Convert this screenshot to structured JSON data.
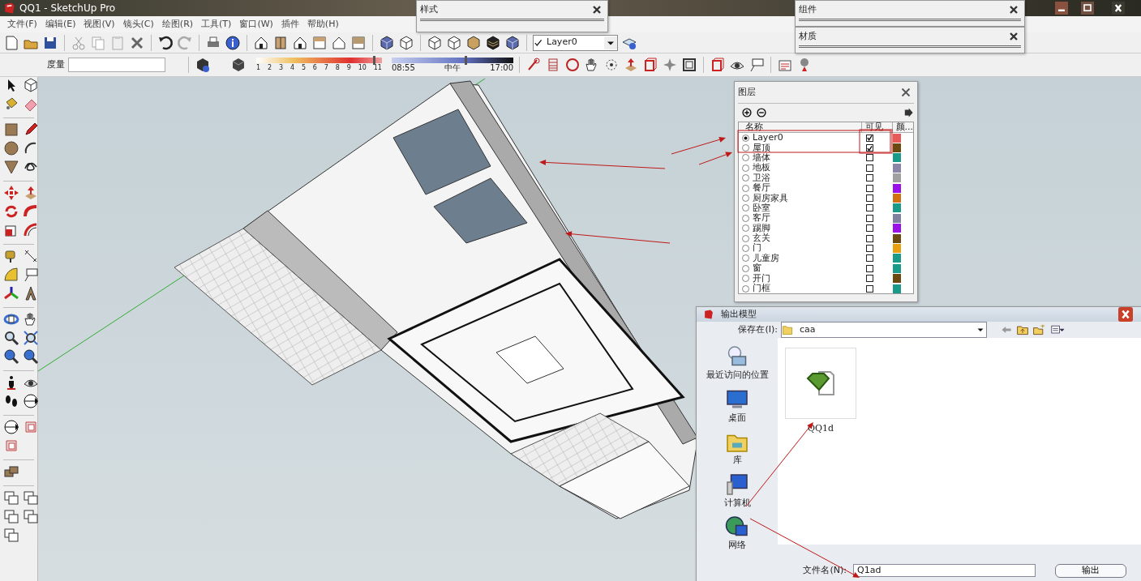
{
  "window": {
    "title": "QQ1 - SketchUp Pro"
  },
  "menu": [
    "文件(F)",
    "编辑(E)",
    "视图(V)",
    "镜头(C)",
    "绘图(R)",
    "工具(T)",
    "窗口(W)",
    "插件",
    "帮助(H)"
  ],
  "layer_select": {
    "value": "Layer0"
  },
  "measure": {
    "label": "度量"
  },
  "shadow": {
    "month_slider": {
      "labels": [
        "1",
        "2",
        "3",
        "4",
        "5",
        "6",
        "7",
        "8",
        "9",
        "10",
        "11"
      ],
      "level": 0.93
    },
    "time_slider": {
      "labels": [
        "08:55",
        "中午",
        "17:00"
      ],
      "level": 0.6
    }
  },
  "panels": [
    {
      "title": "样式"
    },
    {
      "title": "组件"
    },
    {
      "title": "材质"
    }
  ],
  "layers": {
    "title": "图层",
    "columns": [
      "名称",
      "可见",
      "颜..."
    ],
    "rows": [
      {
        "name": "Layer0",
        "selected": true,
        "visible": true,
        "color": "#e85a5a"
      },
      {
        "name": "屋顶",
        "selected": false,
        "visible": true,
        "color": "#6b4a10"
      },
      {
        "name": "墙体",
        "selected": false,
        "visible": false,
        "color": "#1a9b8a"
      },
      {
        "name": "地板",
        "selected": false,
        "visible": false,
        "color": "#8a86a8"
      },
      {
        "name": "卫浴",
        "selected": false,
        "visible": false,
        "color": "#a0a0a0"
      },
      {
        "name": "餐厅",
        "selected": false,
        "visible": false,
        "color": "#9a10e8"
      },
      {
        "name": "厨房家具",
        "selected": false,
        "visible": false,
        "color": "#d07010"
      },
      {
        "name": "卧室",
        "selected": false,
        "visible": false,
        "color": "#1a9b8a"
      },
      {
        "name": "客厅",
        "selected": false,
        "visible": false,
        "color": "#8080a0"
      },
      {
        "name": "踢脚",
        "selected": false,
        "visible": false,
        "color": "#9a10e8"
      },
      {
        "name": "玄关",
        "selected": false,
        "visible": false,
        "color": "#6b4a10"
      },
      {
        "name": "门",
        "selected": false,
        "visible": false,
        "color": "#e8a010"
      },
      {
        "name": "儿童房",
        "selected": false,
        "visible": false,
        "color": "#1a9b8a"
      },
      {
        "name": "窗",
        "selected": false,
        "visible": false,
        "color": "#1a9b8a"
      },
      {
        "name": "开门",
        "selected": false,
        "visible": false,
        "color": "#6b4a10"
      },
      {
        "name": "门框",
        "selected": false,
        "visible": false,
        "color": "#1a9b8a"
      }
    ]
  },
  "export_dialog": {
    "title": "输出模型",
    "save_in_label": "保存在(I):",
    "folder": "caa",
    "places": [
      {
        "label": "最近访问的位置",
        "kind": "recent"
      },
      {
        "label": "桌面",
        "kind": "desktop"
      },
      {
        "label": "库",
        "kind": "library"
      },
      {
        "label": "计算机",
        "kind": "computer"
      },
      {
        "label": "网络",
        "kind": "network"
      }
    ],
    "files": [
      {
        "name": "QQ1d"
      }
    ],
    "filename_label": "文件名(N):",
    "filename": "Q1ad",
    "button": "输出"
  }
}
